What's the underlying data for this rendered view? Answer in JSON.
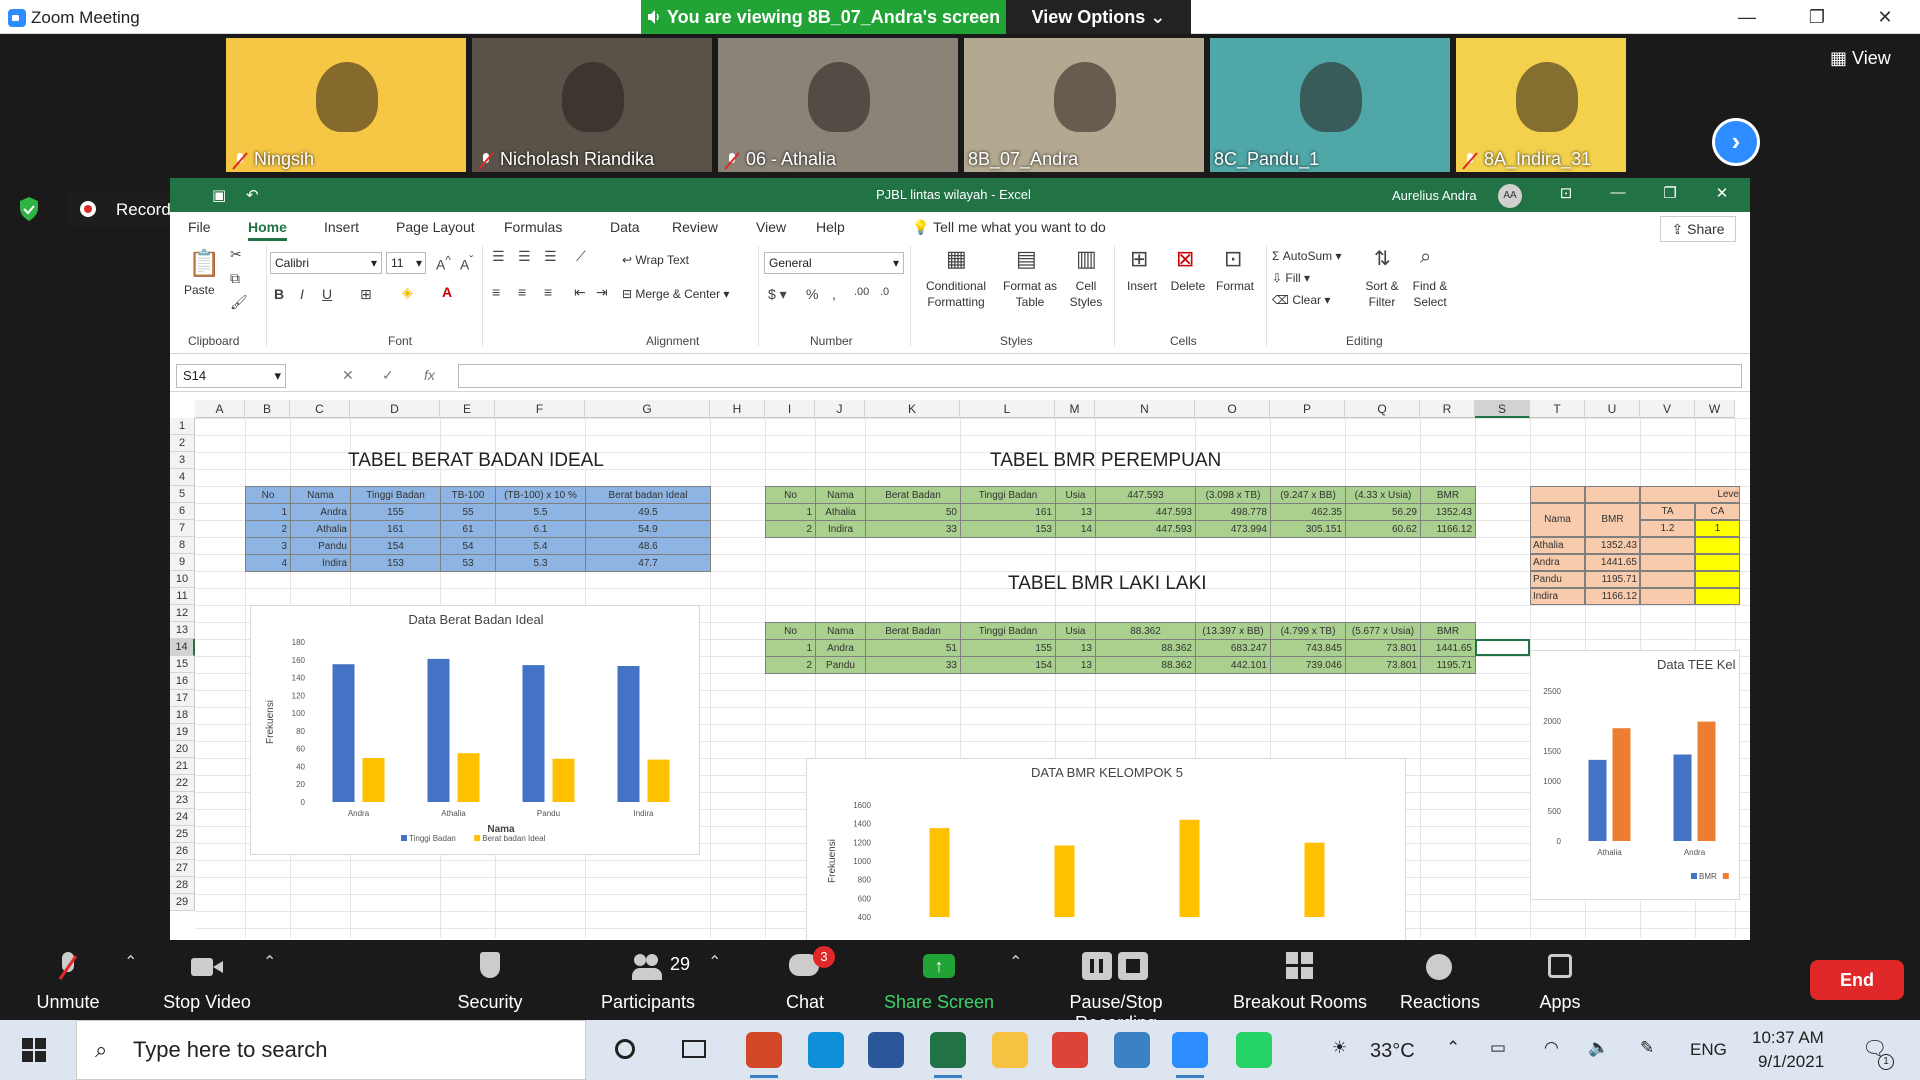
{
  "zoom": {
    "window_title": "Zoom Meeting",
    "viewing_banner": "You are viewing 8B_07_Andra's screen",
    "view_options": "View Options ⌄",
    "view_label": "View",
    "participants": [
      {
        "name": "Ningsih",
        "color": "#f6c744"
      },
      {
        "name": "Nicholash Riandika",
        "color": "#5a5248"
      },
      {
        "name": "06 - Athalia",
        "color": "#8a8378"
      },
      {
        "name": "8B_07_Andra",
        "color": "#b3a890"
      },
      {
        "name": "8C_Pandu_1",
        "color": "#4fa7a8"
      },
      {
        "name": "8A_Indira_31",
        "color": "#f3d14c"
      }
    ],
    "recording_text": "Recording...",
    "toolbar": {
      "unmute": "Unmute",
      "stop_video": "Stop Video",
      "security": "Security",
      "participants": "Participants",
      "participants_count": "29",
      "chat": "Chat",
      "chat_badge": "3",
      "share_screen": "Share Screen",
      "pause_stop_recording": "Pause/Stop Recording",
      "breakout_rooms": "Breakout Rooms",
      "reactions": "Reactions",
      "apps": "Apps",
      "end": "End"
    }
  },
  "excel": {
    "title": "PJBL lintas wilayah  -  Excel",
    "user": "Aurelius Andra",
    "avatar": "AA",
    "menu": [
      "File",
      "Home",
      "Insert",
      "Page Layout",
      "Formulas",
      "Data",
      "Review",
      "View",
      "Help"
    ],
    "tell_me": "Tell me what you want to do",
    "share": "Share",
    "ribbon": {
      "paste": "Paste",
      "clipboard": "Clipboard",
      "font_name": "Calibri",
      "font_size": "11",
      "font": "Font",
      "wrap_text": "Wrap Text",
      "merge_center": "Merge & Center",
      "alignment": "Alignment",
      "number_format": "General",
      "number": "Number",
      "conditional_formatting": "Conditional Formatting",
      "format_as_table": "Format as Table",
      "cell_styles": "Cell Styles",
      "styles": "Styles",
      "insert": "Insert",
      "delete": "Delete",
      "format": "Format",
      "cells": "Cells",
      "autosum": "AutoSum",
      "fill": "Fill",
      "clear": "Clear",
      "sort_filter": "Sort & Filter",
      "find_select": "Find & Select",
      "editing": "Editing"
    },
    "name_box": "S14",
    "columns": [
      "A",
      "B",
      "C",
      "D",
      "E",
      "F",
      "G",
      "H",
      "I",
      "J",
      "K",
      "L",
      "M",
      "N",
      "O",
      "P",
      "Q",
      "R",
      "S",
      "T",
      "U",
      "V",
      "W"
    ],
    "rows": [
      "1",
      "2",
      "3",
      "4",
      "5",
      "6",
      "7",
      "8",
      "9",
      "10",
      "11",
      "12",
      "13",
      "14",
      "15",
      "16",
      "17",
      "18",
      "19",
      "20",
      "21",
      "22",
      "23",
      "24",
      "25",
      "26",
      "27",
      "28",
      "29"
    ],
    "tabel_berat": {
      "title": "TABEL BERAT BADAN IDEAL",
      "headers": [
        "No",
        "Nama",
        "Tinggi Badan",
        "TB-100",
        "(TB-100) x 10 %",
        "Berat badan Ideal"
      ],
      "rows": [
        [
          "1",
          "Andra",
          "155",
          "55",
          "5.5",
          "49.5"
        ],
        [
          "2",
          "Athalia",
          "161",
          "61",
          "6.1",
          "54.9"
        ],
        [
          "3",
          "Pandu",
          "154",
          "54",
          "5.4",
          "48.6"
        ],
        [
          "4",
          "Indira",
          "153",
          "53",
          "5.3",
          "47.7"
        ]
      ]
    },
    "tabel_bmr_p": {
      "title": "TABEL BMR PEREMPUAN",
      "headers": [
        "No",
        "Nama",
        "Berat Badan",
        "Tinggi Badan",
        "Usia",
        "447.593",
        "(3.098 x TB)",
        "(9.247 x BB)",
        "(4.33 x Usia)",
        "BMR"
      ],
      "rows": [
        [
          "1",
          "Athalia",
          "50",
          "161",
          "13",
          "447.593",
          "498.778",
          "462.35",
          "56.29",
          "1352.43"
        ],
        [
          "2",
          "Indira",
          "33",
          "153",
          "14",
          "447.593",
          "473.994",
          "305.151",
          "60.62",
          "1166.12"
        ]
      ]
    },
    "tabel_bmr_l": {
      "title": "TABEL BMR LAKI LAKI",
      "headers": [
        "No",
        "Nama",
        "Berat Badan",
        "Tinggi Badan",
        "Usia",
        "88.362",
        "(13.397 x BB)",
        "(4.799 x TB)",
        "(5.677 x Usia)",
        "BMR"
      ],
      "rows": [
        [
          "1",
          "Andra",
          "51",
          "155",
          "13",
          "88.362",
          "683.247",
          "743.845",
          "73.801",
          "1441.65"
        ],
        [
          "2",
          "Pandu",
          "33",
          "154",
          "13",
          "88.362",
          "442.101",
          "739.046",
          "73.801",
          "1195.71"
        ]
      ]
    },
    "tabel_tee": {
      "headers": [
        "Nama",
        "BMR",
        "Leve",
        "TA",
        "CA"
      ],
      "level_values": [
        "1.2",
        "1"
      ],
      "rows": [
        [
          "Athalia",
          "1352.43"
        ],
        [
          "Andra",
          "1441.65"
        ],
        [
          "Pandu",
          "1195.71"
        ],
        [
          "Indira",
          "1166.12"
        ]
      ]
    }
  },
  "chart_data": [
    {
      "type": "bar",
      "title": "Data Berat Badan Ideal",
      "xlabel": "Nama",
      "ylabel": "Frekuensi",
      "categories": [
        "Andra",
        "Athalia",
        "Pandu",
        "Indira"
      ],
      "series": [
        {
          "name": "Tinggi Badan",
          "values": [
            155,
            161,
            154,
            153
          ],
          "color": "#4472c4"
        },
        {
          "name": "Berat badan Ideal",
          "values": [
            49.5,
            54.9,
            48.6,
            47.7
          ],
          "color": "#ffc000"
        }
      ],
      "ylim": [
        0,
        180
      ],
      "yticks": [
        0,
        20,
        40,
        60,
        80,
        100,
        120,
        140,
        160,
        180
      ],
      "legend": "bottom"
    },
    {
      "type": "bar",
      "title": "DATA BMR KELOMPOK 5",
      "ylabel": "Frekuensi",
      "series": [
        {
          "values": [
            1352.43,
            1166.12,
            1441.65,
            1195.71
          ],
          "color": "#ffc000"
        }
      ],
      "ylim": [
        400,
        1600
      ],
      "yticks": [
        400,
        600,
        800,
        1000,
        1200,
        1400,
        1600
      ]
    },
    {
      "type": "bar",
      "title": "Data TEE Kel",
      "categories": [
        "Athalia",
        "Andra"
      ],
      "series": [
        {
          "name": "BMR",
          "values": [
            1352.43,
            1441.65
          ],
          "color": "#4472c4"
        },
        {
          "values": [
            1880,
            1990
          ],
          "color": "#ed7d31"
        }
      ],
      "ylim": [
        0,
        2500
      ],
      "yticks": [
        0,
        500,
        1000,
        1500,
        2000,
        2500
      ],
      "legend": "bottom"
    }
  ],
  "taskbar": {
    "search_placeholder": "Type here to search",
    "weather": "33°C",
    "language": "ENG",
    "time": "10:37 AM",
    "date": "9/1/2021",
    "notifications": "1"
  }
}
